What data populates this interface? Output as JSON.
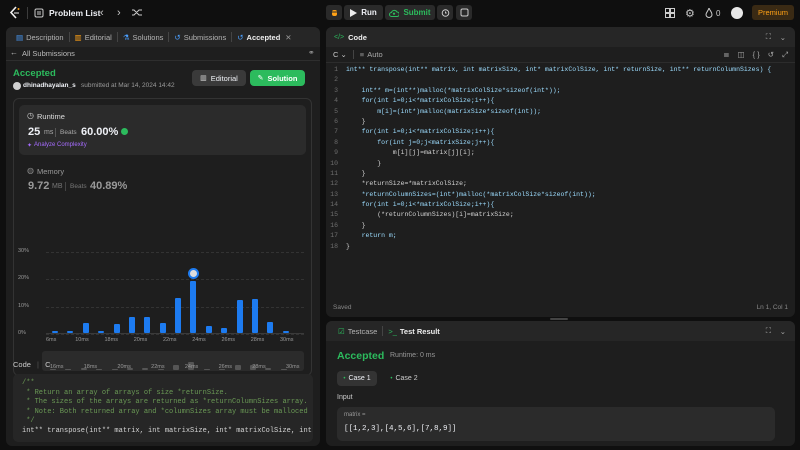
{
  "topbar": {
    "problem_list": "Problem List",
    "run": "Run",
    "submit": "Submit",
    "likes": "0",
    "premium": "Premium"
  },
  "left": {
    "tabs": [
      "Description",
      "Editorial",
      "Solutions",
      "Submissions",
      "Accepted"
    ],
    "all_submissions": "All Submissions",
    "status": "Accepted",
    "user": "dhinadhayalan_s",
    "submitted": "submitted at Mar 14, 2024 14:42",
    "editorial_btn": "Editorial",
    "solution_btn": "Solution",
    "runtime_label": "Runtime",
    "runtime_value": "25",
    "runtime_unit": "ms",
    "beats_label": "Beats",
    "runtime_beats": "60.00%",
    "analyze": "Analyze Complexity",
    "memory_label": "Memory",
    "memory_value": "9.72",
    "memory_unit": "MB",
    "memory_beats": "40.89%",
    "code_tab": "Code",
    "lang": "C"
  },
  "chart_data": {
    "type": "bar",
    "ylabel_ticks": [
      "30%",
      "20%",
      "10%",
      "0%"
    ],
    "ylim": [
      0,
      30
    ],
    "x_tick_labels": [
      "6ms",
      "10ms",
      "18ms",
      "20ms",
      "22ms",
      "24ms",
      "26ms",
      "28ms",
      "30ms"
    ],
    "values": [
      0.6,
      0.8,
      3.8,
      0.8,
      3.4,
      6.0,
      5.7,
      3.6,
      12.8,
      19.0,
      2.5,
      1.7,
      12.2,
      12.5,
      4.0,
      0.8
    ],
    "highlight_index": 9,
    "minimap_x_labels": [
      "16ms",
      "18ms",
      "20ms",
      "22ms",
      "24ms",
      "26ms",
      "28ms",
      "30ms"
    ]
  },
  "code_preview": [
    "/**",
    " * Return an array of arrays of size *returnSize.",
    " * The sizes of the arrays are returned as *returnColumnSizes array.",
    " * Note: Both returned array and *columnSizes array must be malloced",
    " */",
    "int** transpose(int** matrix, int matrixSize, int* matrixColSize, int"
  ],
  "editor": {
    "title": "Code",
    "lang": "C",
    "auto": "Auto",
    "saved": "Saved",
    "cursor": "Ln 1, Col 1",
    "lines": [
      "int** transpose(int** matrix, int matrixSize, int* matrixColSize, int* returnSize, int** returnColumnSizes) {",
      "",
      "    int** m=(int**)malloc(*matrixColSize*sizeof(int*));",
      "    for(int i=0;i<*matrixColSize;i++){",
      "        m[i]=(int*)malloc(matrixSize*sizeof(int));",
      "    }",
      "    for(int i=0;i<*matrixColSize;i++){",
      "        for(int j=0;j<matrixSize;j++){",
      "            m[i][j]=matrix[j][i];",
      "        }",
      "    }",
      "    *returnSize=*matrixColSize;",
      "    *returnColumnSizes=(int*)malloc(*matrixColSize*sizeof(int));",
      "    for(int i=0;i<*matrixColSize;i++){",
      "        (*returnColumnSizes)[i]=matrixSize;",
      "    }",
      "    return m;",
      "}"
    ]
  },
  "bottom": {
    "testcase_tab": "Testcase",
    "result_tab": "Test Result",
    "status": "Accepted",
    "runtime": "Runtime: 0 ms",
    "case1": "Case 1",
    "case2": "Case 2",
    "input_label": "Input",
    "var_name": "matrix =",
    "var_value": "[[1,2,3],[4,5,6],[7,8,9]]"
  },
  "colors": {
    "accent_green": "#2cbb5d",
    "bar_blue": "#1d7bf0",
    "premium": "#ffa116"
  }
}
